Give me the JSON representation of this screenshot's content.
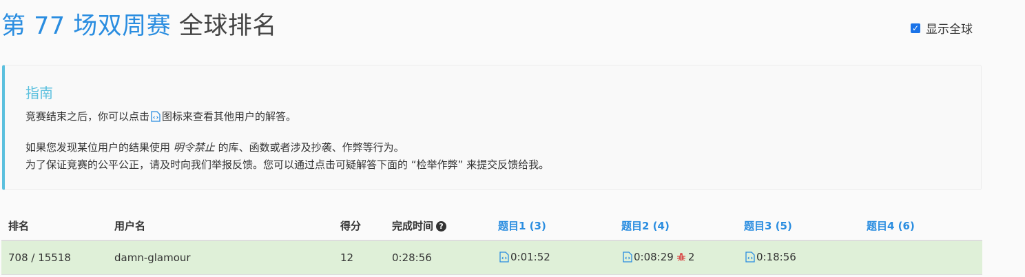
{
  "page": {
    "title_highlight": "第 77 场双周赛",
    "title_rest": " 全球排名",
    "show_global_label": "显示全球",
    "show_global_checked": true
  },
  "guide": {
    "heading": "指南",
    "line1_before": "竞赛结束之后，你可以点击",
    "line1_after": "图标来查看其他用户的解答。",
    "line2_before": "如果您发现某位用户的结果使用 ",
    "line2_em": "明令禁止",
    "line2_after": " 的库、函数或者涉及抄袭、作弊等行为。",
    "line3": "为了保证竞赛的公平公正，请及时向我们举报反馈。您可以通过点击可疑解答下面的 “检举作弊” 来提交反馈给我。"
  },
  "table": {
    "headers": {
      "rank": "排名",
      "user": "用户名",
      "score": "得分",
      "finish_time": "完成时间",
      "q1": "题目1 (3)",
      "q2": "题目2 (4)",
      "q3": "题目3 (5)",
      "q4": "题目4 (6)"
    },
    "row": {
      "rank": "708 / 15518",
      "user": "damn-glamour",
      "score": "12",
      "finish_time": "0:28:56",
      "q1_time": "0:01:52",
      "q2_time": "0:08:29",
      "q2_penalty": "2",
      "q3_time": "0:18:56",
      "q4_time": ""
    }
  },
  "icons": [
    "code-file-icon",
    "bug-icon",
    "help-icon",
    "checkbox-check-icon"
  ],
  "colors": {
    "accent": "#2a8de0",
    "guide_border": "#5bc0de",
    "row_bg": "#dff0d8",
    "bug": "#d9534f"
  }
}
